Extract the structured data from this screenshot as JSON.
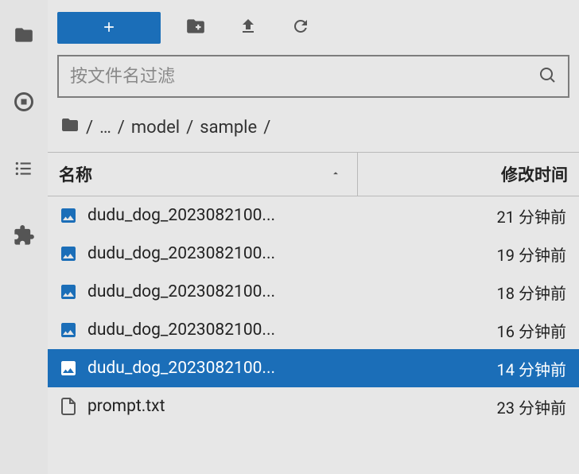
{
  "sidebar": {
    "items": [
      {
        "name": "folder"
      },
      {
        "name": "stop"
      },
      {
        "name": "list"
      },
      {
        "name": "extension"
      }
    ]
  },
  "toolbar": {
    "new_label": "+",
    "items": [
      {
        "name": "new-folder"
      },
      {
        "name": "upload"
      },
      {
        "name": "refresh"
      }
    ]
  },
  "filter": {
    "placeholder": "按文件名过滤"
  },
  "breadcrumb": {
    "ellipsis": "…",
    "segments": [
      "model",
      "sample"
    ],
    "sep": "/"
  },
  "columns": {
    "name": "名称",
    "mtime": "修改时间"
  },
  "files": [
    {
      "type": "image",
      "name": "dudu_dog_2023082100...",
      "mtime": "21 分钟前",
      "selected": false
    },
    {
      "type": "image",
      "name": "dudu_dog_2023082100...",
      "mtime": "19 分钟前",
      "selected": false
    },
    {
      "type": "image",
      "name": "dudu_dog_2023082100...",
      "mtime": "18 分钟前",
      "selected": false
    },
    {
      "type": "image",
      "name": "dudu_dog_2023082100...",
      "mtime": "16 分钟前",
      "selected": false
    },
    {
      "type": "image",
      "name": "dudu_dog_2023082100...",
      "mtime": "14 分钟前",
      "selected": true
    },
    {
      "type": "text",
      "name": "prompt.txt",
      "mtime": "23 分钟前",
      "selected": false
    }
  ]
}
